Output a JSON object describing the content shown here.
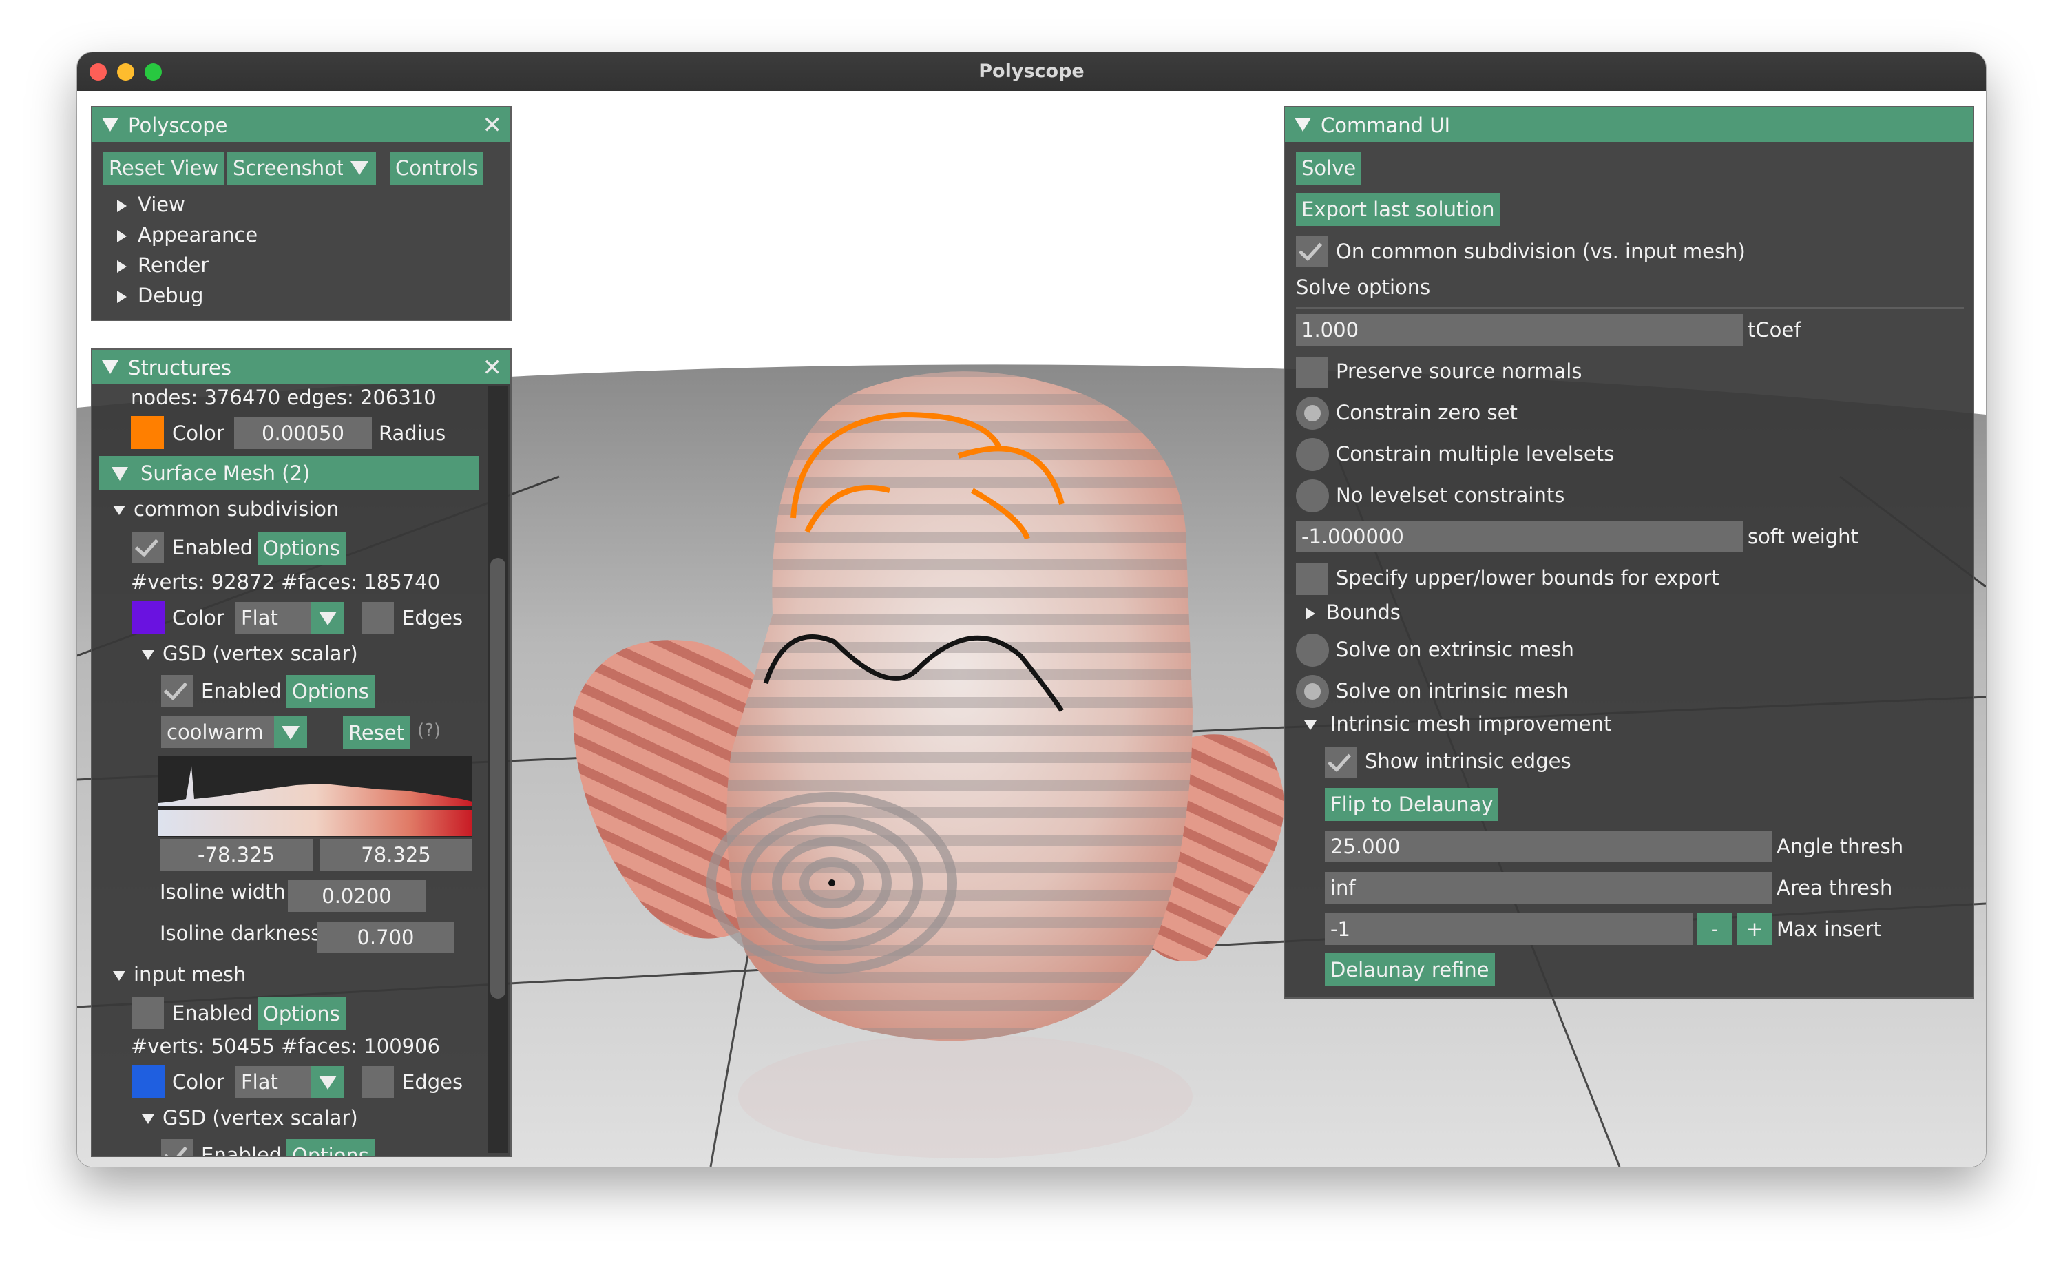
{
  "window": {
    "title": "Polyscope"
  },
  "colors": {
    "accent": "#4f9a77",
    "curve_color": "#ff7f00",
    "common_subdivision_color": "#6a12e0",
    "input_mesh_color": "#1f5fe0"
  },
  "polyscope_panel": {
    "title": "Polyscope",
    "close": "✕",
    "buttons": {
      "reset_view": "Reset View",
      "screenshot": "Screenshot",
      "controls": "Controls"
    },
    "tree": [
      "View",
      "Appearance",
      "Render",
      "Debug"
    ]
  },
  "structures_panel": {
    "title": "Structures",
    "close": "✕",
    "curve_stats": "nodes: 376470  edges: 206310",
    "curve_color_label": "Color",
    "radius_value": "0.00050",
    "radius_label": "Radius",
    "surface_mesh_header": "Surface Mesh (2)",
    "common_subdivision": {
      "name": "common subdivision",
      "enabled_label": "Enabled",
      "options_label": "Options",
      "stats": "#verts: 92872  #faces: 185740",
      "color_label": "Color",
      "shade_mode": "Flat",
      "edges_label": "Edges",
      "quantity": {
        "name": "GSD (vertex scalar)",
        "enabled_label": "Enabled",
        "options_label": "Options",
        "colormap": "coolwarm",
        "reset_label": "Reset",
        "help": "(?)",
        "range_min": "-78.325",
        "range_max": "78.325",
        "isoline_width_label": "Isoline width",
        "isoline_width": "0.0200",
        "isoline_darkness_label": "Isoline darkness",
        "isoline_darkness": "0.700"
      }
    },
    "input_mesh": {
      "name": "input mesh",
      "enabled_label": "Enabled",
      "options_label": "Options",
      "stats": "#verts: 50455  #faces: 100906",
      "color_label": "Color",
      "shade_mode": "Flat",
      "edges_label": "Edges",
      "quantity_name": "GSD (vertex scalar)",
      "quantity_enabled_label": "Enabled",
      "quantity_options_label": "Options"
    }
  },
  "command_panel": {
    "title": "Command UI",
    "solve": "Solve",
    "export": "Export last solution",
    "on_common_subdivision": "On common subdivision (vs. input mesh)",
    "solve_options": "Solve options",
    "tcoef_value": "1.000",
    "tcoef_label": "tCoef",
    "preserve_normals": "Preserve source normals",
    "constrain_zero_set": "Constrain zero set",
    "constrain_multiple": "Constrain multiple levelsets",
    "no_levelset": "No levelset constraints",
    "soft_weight_value": "-1.000000",
    "soft_weight_label": "soft weight",
    "specify_bounds": "Specify upper/lower bounds for export",
    "bounds": "Bounds",
    "solve_extrinsic": "Solve on extrinsic mesh",
    "solve_intrinsic": "Solve on intrinsic mesh",
    "intrinsic_improvement": "Intrinsic mesh improvement",
    "show_intrinsic_edges": "Show intrinsic edges",
    "flip_to_delaunay": "Flip to Delaunay",
    "angle_thresh_value": "25.000",
    "angle_thresh_label": "Angle thresh",
    "area_thresh_value": "inf",
    "area_thresh_label": "Area thresh",
    "max_insert_value": "-1",
    "minus": "-",
    "plus": "+",
    "max_insert_label": "Max insert",
    "delaunay_refine": "Delaunay refine"
  }
}
